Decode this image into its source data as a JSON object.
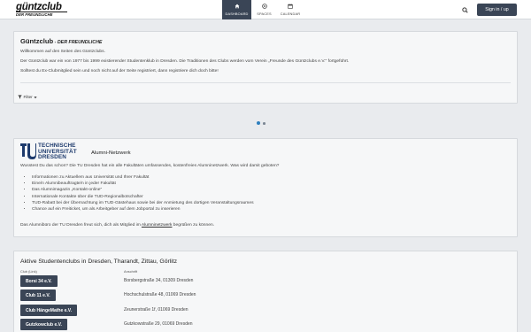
{
  "header": {
    "logo_line1": "güntzclub",
    "logo_line2": "DER FREUNDLICHE",
    "nav": [
      {
        "label": "DASHBOARD",
        "icon": "home-icon",
        "active": true
      },
      {
        "label": "SPACES",
        "icon": "target-icon",
        "active": false
      },
      {
        "label": "CALENDAR",
        "icon": "calendar-icon",
        "active": false
      }
    ],
    "search_icon": "search-icon",
    "signin_label": "Sign in / up"
  },
  "welcome": {
    "title": "Güntzclub",
    "title_sub": " - DER FREUNDLICHE",
    "p1": "Willkommen auf den Seiten des Güntzclubs.",
    "p2": "Der Güntzclub war ein von 1977 bis 1999 existierender Studentenklub in Dresden. Die Traditionen des Clubs werden vom Verein „Freunde des Güntzclubs e.V.\" fortgeführt.",
    "p3": "Solltest du Ex-Clubmitglied sein und noch nicht auf der Seite registriert, dann registriere dich doch bitte!",
    "filter_label": "Filter"
  },
  "alumni": {
    "logo_line1": "TECHNISCHE",
    "logo_line2": "UNIVERSITÄT",
    "logo_line3": "DRESDEN",
    "title": "Alumni-Netzwerk",
    "intro": "Wusstest Du das schon? Die TU Dresden hat ein alle Fakultäten umfassendes, kostenfreies Alumninetzwerk. Was wird damit geboten?",
    "items": [
      "Informationen zu Aktuellem aus Universität und Ihrer Fakultät",
      "Eine/n Alumnibeauftragte/n in jeder Fakultät",
      "Das Alumnimagazin „Kontakt-online\"",
      "Internationale Kontakte über die TUD-Regionalbotschafter",
      "TUD-Rabatt bei der Übernachtung im TUD-Gästehaus sowie bei der Anmietung des dortigen Veranstaltungsraumes",
      "Chance auf ein Freiticket, um als Arbeitgeber auf dem Jobportal zu inserieren"
    ],
    "outro_before": "Das Alumnibüro der TU Dresden freut sich, dich als Mitglied im ",
    "outro_link": "Alumninetzwerk",
    "outro_after": " begrüßen zu können."
  },
  "clubs": {
    "title": "Aktive Studentenclubs in Dresden, Tharandt, Zittau, Görlitz",
    "col_club": "Club (Link)",
    "col_address": "Anschrift",
    "rows": [
      {
        "name": "Borsi 34 e.V.",
        "address": "Borsbergstraße 34, 01309 Dresden"
      },
      {
        "name": "Club 11 e.V.",
        "address": "Hochschulstraße 48, 01069 Dresden"
      },
      {
        "name": "Club HängeMathe e.V.",
        "address": "Zeunerstraße 1f, 01069 Dresden"
      },
      {
        "name": "Gutzkowclub e.V.",
        "address": "Gutzkowstraße 29, 01069 Dresden"
      }
    ]
  }
}
